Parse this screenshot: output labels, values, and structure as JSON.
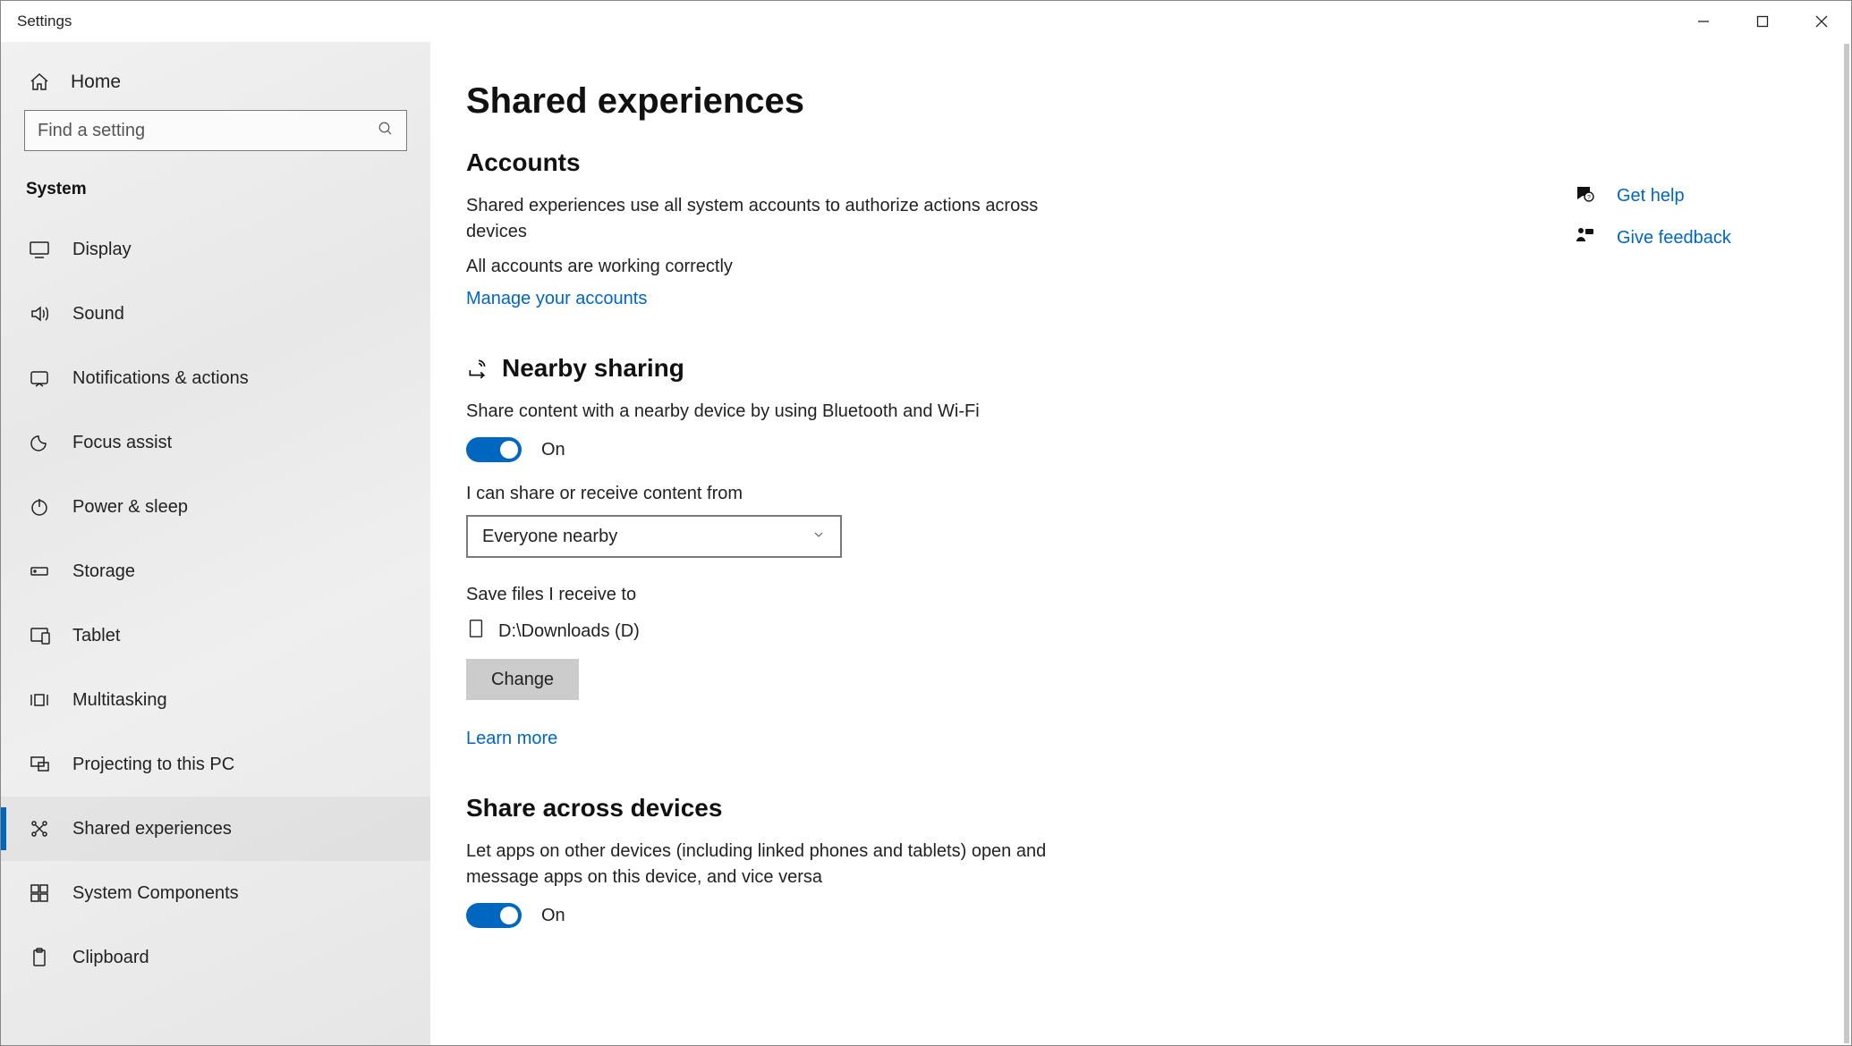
{
  "window": {
    "title": "Settings"
  },
  "sidebar": {
    "home": "Home",
    "search_placeholder": "Find a setting",
    "category": "System",
    "items": [
      {
        "label": "Display"
      },
      {
        "label": "Sound"
      },
      {
        "label": "Notifications & actions"
      },
      {
        "label": "Focus assist"
      },
      {
        "label": "Power & sleep"
      },
      {
        "label": "Storage"
      },
      {
        "label": "Tablet"
      },
      {
        "label": "Multitasking"
      },
      {
        "label": "Projecting to this PC"
      },
      {
        "label": "Shared experiences"
      },
      {
        "label": "System Components"
      },
      {
        "label": "Clipboard"
      }
    ]
  },
  "page": {
    "title": "Shared experiences",
    "accounts": {
      "heading": "Accounts",
      "desc": "Shared experiences use all system accounts to authorize actions across devices",
      "status": "All accounts are working correctly",
      "manage_link": "Manage your accounts"
    },
    "nearby": {
      "heading": "Nearby sharing",
      "desc": "Share content with a nearby device by using Bluetooth and Wi-Fi",
      "toggle_state": "On",
      "receive_label": "I can share or receive content from",
      "receive_value": "Everyone nearby",
      "save_label": "Save files I receive to",
      "save_path": "D:\\Downloads (D)",
      "change_button": "Change",
      "learn_more": "Learn more"
    },
    "across": {
      "heading": "Share across devices",
      "desc": "Let apps on other devices (including linked phones and tablets) open and message apps on this device, and vice versa",
      "toggle_state": "On"
    }
  },
  "aside": {
    "help": "Get help",
    "feedback": "Give feedback"
  }
}
